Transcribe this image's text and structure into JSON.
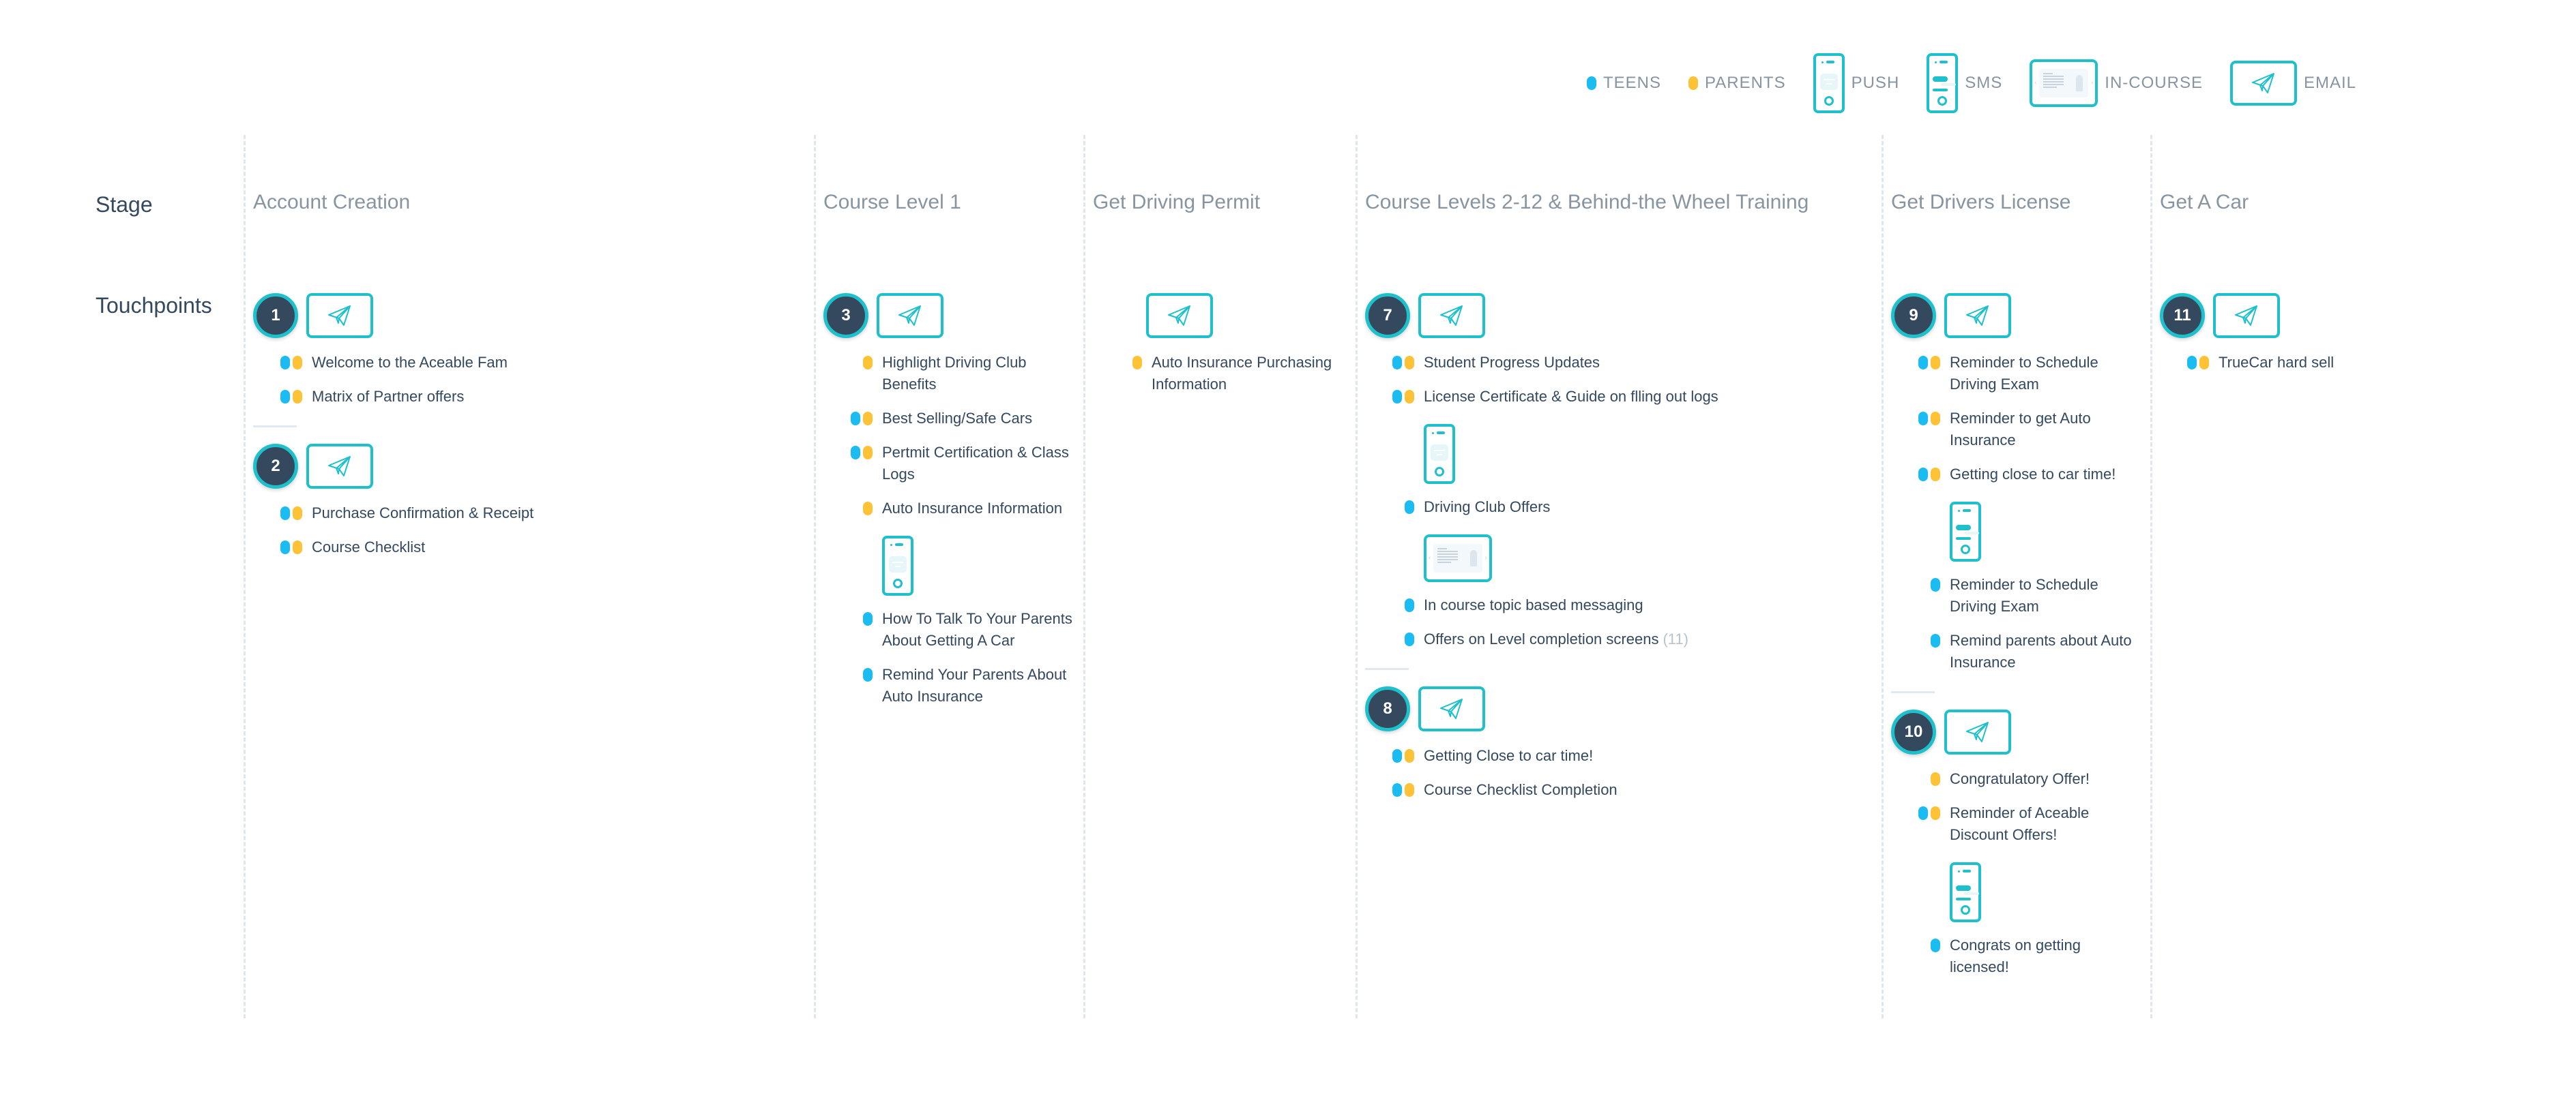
{
  "legend": [
    {
      "type": "dot",
      "audience": "teen",
      "label": "TEENS",
      "icon": "teen-dot"
    },
    {
      "type": "dot",
      "audience": "parent",
      "label": "PARENTS",
      "icon": "parent-dot"
    },
    {
      "type": "push",
      "label": "PUSH",
      "icon": "push-phone-icon"
    },
    {
      "type": "sms",
      "label": "SMS",
      "icon": "sms-phone-icon"
    },
    {
      "type": "incourse",
      "label": "IN-COURSE",
      "icon": "in-course-icon"
    },
    {
      "type": "email",
      "label": "EMAIL",
      "icon": "email-paper-plane-icon"
    }
  ],
  "colors": {
    "teen": "#1bbcf2",
    "parent": "#fdc236",
    "accent": "#1ec0cc",
    "badge": "#34495e",
    "stage_text": "#8795a1",
    "body_text": "#34495e"
  },
  "rows": {
    "stage_label": "Stage",
    "touchpoints_label": "Touchpoints"
  },
  "stages": [
    {
      "title": "Account Creation",
      "touchpoints": [
        {
          "number": "1",
          "channel": "email",
          "messages": [
            {
              "audience": [
                "teen",
                "parent"
              ],
              "text": "Welcome to the Aceable Fam"
            },
            {
              "audience": [
                "teen",
                "parent"
              ],
              "text": "Matrix of Partner offers"
            }
          ]
        },
        {
          "number": "2",
          "channel": "email",
          "messages": [
            {
              "audience": [
                "teen",
                "parent"
              ],
              "text": "Purchase Confirmation & Receipt"
            },
            {
              "audience": [
                "teen",
                "parent"
              ],
              "text": "Course Checklist"
            }
          ]
        }
      ]
    },
    {
      "title": "Course Level 1",
      "touchpoints": [
        {
          "number": "3",
          "channel": "email",
          "messages": [
            {
              "audience": [
                "parent"
              ],
              "text": "Highlight Driving Club Benefits"
            },
            {
              "audience": [
                "teen",
                "parent"
              ],
              "text": "Best Selling/Safe Cars"
            },
            {
              "audience": [
                "teen",
                "parent"
              ],
              "text": "Pertmit Certification & Class Logs"
            },
            {
              "audience": [
                "parent"
              ],
              "text": "Auto Insurance Information"
            },
            {
              "channel_icon": "push"
            },
            {
              "audience": [
                "teen"
              ],
              "text": "How To Talk To Your Parents About Getting A Car"
            },
            {
              "audience": [
                "teen"
              ],
              "text": "Remind Your Parents About Auto Insurance"
            }
          ]
        }
      ]
    },
    {
      "title": "Get Driving Permit",
      "touchpoints": [
        {
          "number": "",
          "channel": "email",
          "messages": [
            {
              "audience": [
                "parent"
              ],
              "text": "Auto Insurance Purchasing Information"
            }
          ]
        }
      ]
    },
    {
      "title": "Course Levels 2-12 & Behind-the Wheel Training",
      "touchpoints": [
        {
          "number": "7",
          "channel": "email",
          "messages": [
            {
              "audience": [
                "teen",
                "parent"
              ],
              "text": "Student Progress Updates"
            },
            {
              "audience": [
                "teen",
                "parent"
              ],
              "text": "License Certificate & Guide on flling out logs"
            },
            {
              "channel_icon": "push"
            },
            {
              "audience": [
                "teen"
              ],
              "text": "Driving Club Offers"
            },
            {
              "channel_icon": "incourse"
            },
            {
              "audience": [
                "teen"
              ],
              "text": "In course topic based messaging"
            },
            {
              "audience": [
                "teen"
              ],
              "text": "Offers on Level completion screens",
              "count": "(11)"
            }
          ]
        },
        {
          "number": "8",
          "channel": "email",
          "messages": [
            {
              "audience": [
                "teen",
                "parent"
              ],
              "text": "Getting Close to car time!"
            },
            {
              "audience": [
                "teen",
                "parent"
              ],
              "text": "Course Checklist Completion"
            }
          ]
        }
      ]
    },
    {
      "title": "Get Drivers License",
      "touchpoints": [
        {
          "number": "9",
          "channel": "email",
          "messages": [
            {
              "audience": [
                "teen",
                "parent"
              ],
              "text": "Reminder to Schedule Driving Exam"
            },
            {
              "audience": [
                "teen",
                "parent"
              ],
              "text": "Reminder to get Auto Insurance"
            },
            {
              "audience": [
                "teen",
                "parent"
              ],
              "text": "Getting close to car time!"
            },
            {
              "channel_icon": "sms"
            },
            {
              "audience": [
                "teen"
              ],
              "text": "Reminder to Schedule Driving Exam"
            },
            {
              "audience": [
                "teen"
              ],
              "text": "Remind parents about Auto Insurance"
            }
          ]
        },
        {
          "number": "10",
          "channel": "email",
          "messages": [
            {
              "audience": [
                "parent"
              ],
              "text": "Congratulatory Offer!"
            },
            {
              "audience": [
                "teen",
                "parent"
              ],
              "text": "Reminder of Aceable Discount Offers!"
            },
            {
              "channel_icon": "sms"
            },
            {
              "audience": [
                "teen"
              ],
              "text": "Congrats on getting licensed!"
            }
          ]
        }
      ]
    },
    {
      "title": "Get A Car",
      "touchpoints": [
        {
          "number": "11",
          "channel": "email",
          "messages": [
            {
              "audience": [
                "teen",
                "parent"
              ],
              "text": "TrueCar hard sell"
            }
          ]
        }
      ]
    }
  ]
}
